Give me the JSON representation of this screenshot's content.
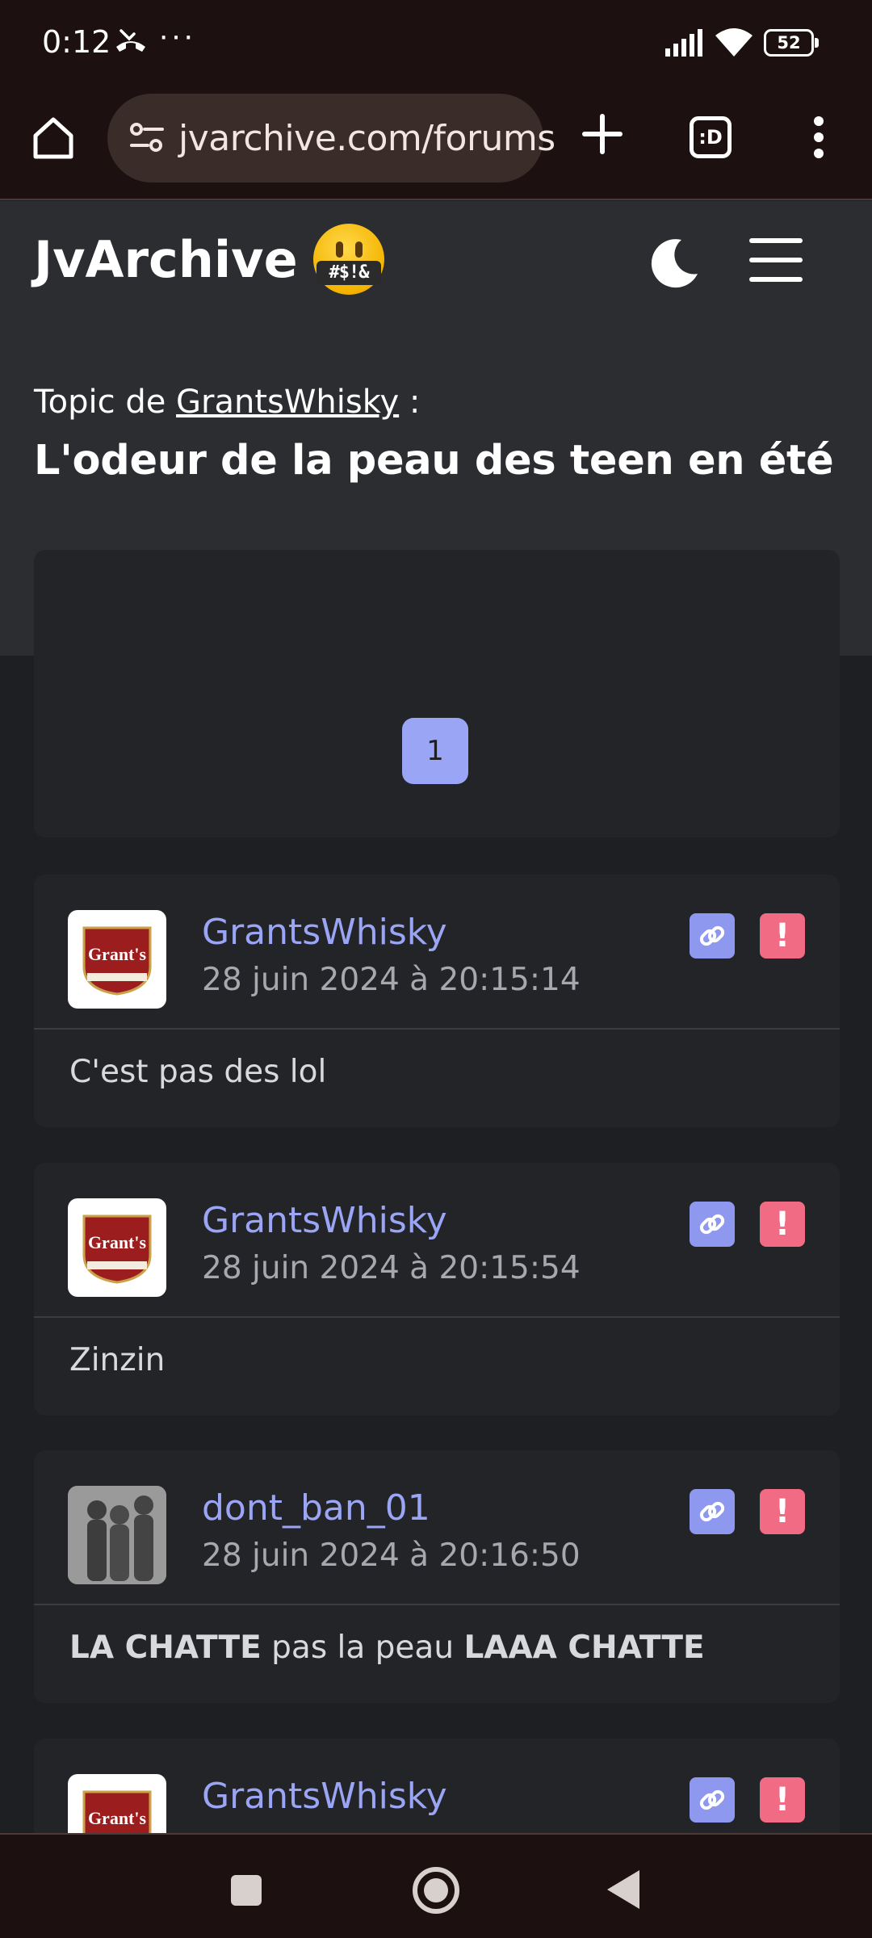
{
  "status_bar": {
    "time": "0:12",
    "battery": "52"
  },
  "browser": {
    "url": "jvarchive.com/forums",
    "tabs_label": ":D"
  },
  "site": {
    "logo": "JvArchive",
    "emoji_text": "#$!&"
  },
  "topic": {
    "prefix": "Topic de ",
    "author": "GrantsWhisky",
    "suffix": " :",
    "title": "L'odeur de la peau des teen en été"
  },
  "pagination": {
    "current_page": "1"
  },
  "posts": [
    {
      "author": "GrantsWhisky",
      "date": "28 juin 2024 à 20:15:14",
      "avatar_text": "Grant's",
      "body": [
        {
          "text": "C'est pas des lol",
          "bold": false
        }
      ]
    },
    {
      "author": "GrantsWhisky",
      "date": "28 juin 2024 à 20:15:54",
      "avatar_text": "Grant's",
      "body": [
        {
          "text": "Zinzin",
          "bold": false
        }
      ]
    },
    {
      "author": "dont_ban_01",
      "date": "28 juin 2024 à 20:16:50",
      "avatar_text": "",
      "body": [
        {
          "text": "LA CHATTE",
          "bold": true
        },
        {
          "text": " pas la peau ",
          "bold": false
        },
        {
          "text": "LAAA CHATTE",
          "bold": true
        }
      ]
    },
    {
      "author": "GrantsWhisky",
      "date": "",
      "avatar_text": "Grant's",
      "body": []
    }
  ],
  "colors": {
    "accent": "#9aa5f5",
    "report": "#f26b84",
    "link_button": "#8e98ef",
    "card_bg": "#232428",
    "header_bg": "#2b2d31"
  },
  "icons": [
    "call-missed-icon",
    "signal-icon",
    "wifi-icon",
    "battery-icon",
    "home-icon",
    "site-settings-icon",
    "plus-icon",
    "more-vert-icon",
    "moon-icon",
    "menu-icon",
    "link-icon",
    "report-icon"
  ]
}
